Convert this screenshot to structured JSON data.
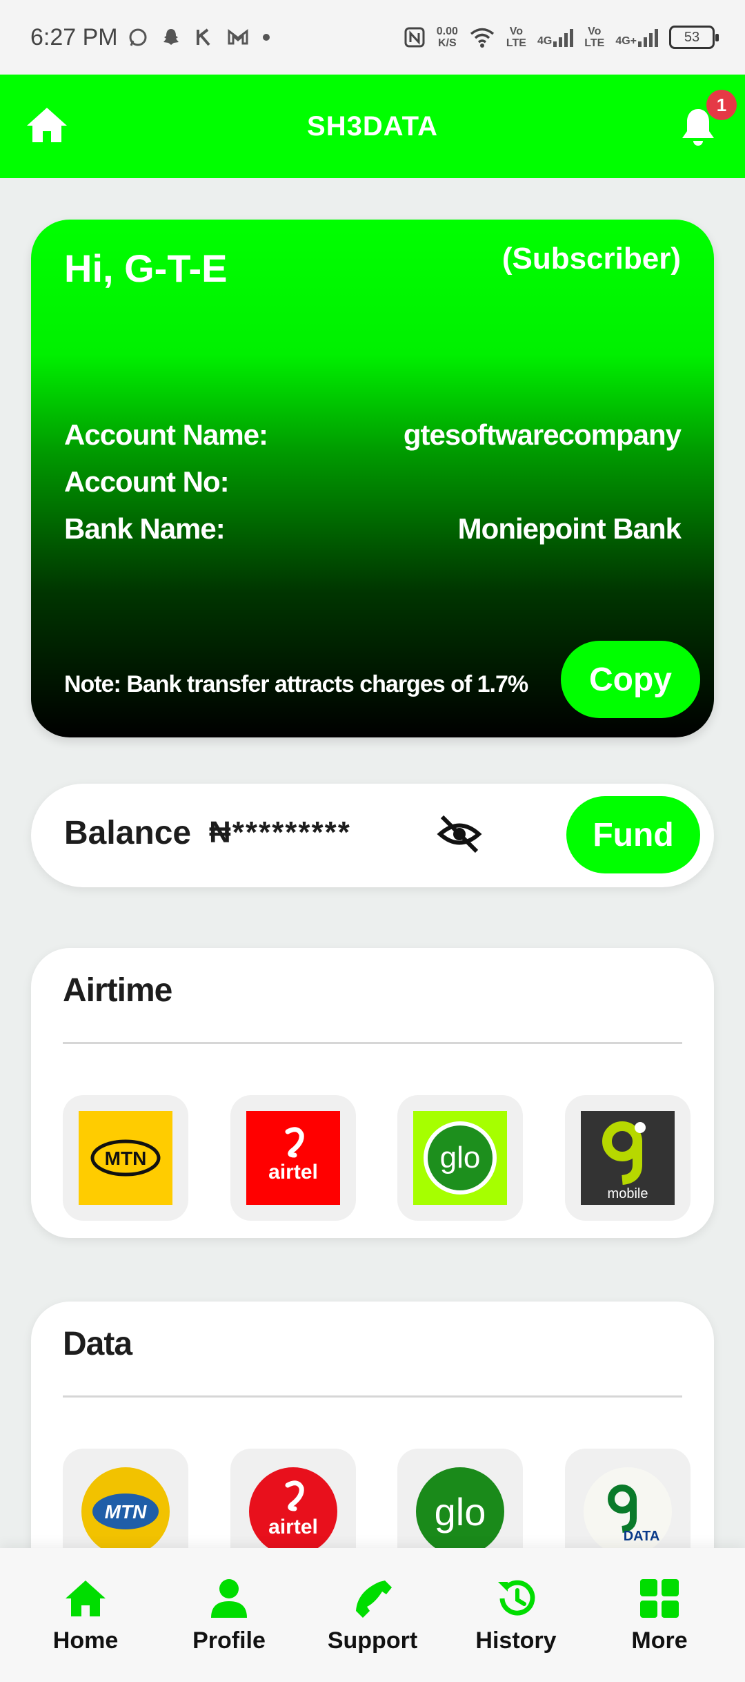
{
  "status_bar": {
    "time": "6:27 PM",
    "net_speed_value": "0.00",
    "net_speed_unit": "K/S",
    "volte1_top": "Vo",
    "volte1_bottom": "LTE",
    "sig1_label": "4G",
    "volte2_top": "Vo",
    "volte2_bottom": "LTE",
    "sig2_label": "4G+",
    "battery": "53"
  },
  "app_bar": {
    "title": "SH3DATA",
    "notification_count": "1",
    "accent_color": "#00ff00"
  },
  "account": {
    "greeting": "Hi, G-T-E",
    "role": "(Subscriber)",
    "account_name_label": "Account Name:",
    "account_name_value": "gtesoftwarecompany",
    "account_no_label": "Account No:",
    "account_no_value": "",
    "bank_name_label": "Bank Name:",
    "bank_name_value": "Moniepoint Bank",
    "note": "Note: Bank transfer attracts charges of 1.7%",
    "copy_label": "Copy"
  },
  "balance": {
    "label": "Balance",
    "currency": "₦",
    "masked_value": "*********",
    "fund_label": "Fund"
  },
  "airtime": {
    "title": "Airtime",
    "providers": [
      {
        "name": "MTN",
        "icon": "mtn-logo"
      },
      {
        "name": "airtel",
        "icon": "airtel-logo"
      },
      {
        "name": "glo",
        "icon": "glo-logo"
      },
      {
        "name": "mobile",
        "icon": "9mobile-logo"
      }
    ]
  },
  "data": {
    "title": "Data",
    "providers": [
      {
        "name": "MTN",
        "icon": "mtn-logo"
      },
      {
        "name": "airtel",
        "icon": "airtel-logo"
      },
      {
        "name": "glo",
        "icon": "glo-logo"
      },
      {
        "name": "DATA",
        "icon": "9mobile-data-logo"
      }
    ]
  },
  "bottom_nav": [
    {
      "label": "Home",
      "icon": "home-icon"
    },
    {
      "label": "Profile",
      "icon": "profile-icon"
    },
    {
      "label": "Support",
      "icon": "phone-icon"
    },
    {
      "label": "History",
      "icon": "history-icon"
    },
    {
      "label": "More",
      "icon": "grid-icon"
    }
  ]
}
